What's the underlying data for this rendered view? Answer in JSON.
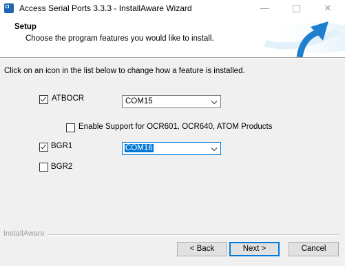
{
  "window": {
    "title": "Access Serial Ports 3.3.3 - InstallAware Wizard",
    "icon": "installaware-app-icon",
    "minimize_glyph": "—",
    "close_glyph": "✕"
  },
  "header": {
    "title": "Setup",
    "subtitle": "Choose the program features you would like to install."
  },
  "instruction": "Click on an icon in the list below to change how a feature is installed.",
  "features": {
    "atbocr": {
      "label": "ATBOCR",
      "checked": true,
      "port": "COM15"
    },
    "ocr_support": {
      "label": "Enable Support for OCR601, OCR640, ATOM Products",
      "checked": false
    },
    "bgr1": {
      "label": "BGR1",
      "checked": true,
      "port": "COM16"
    },
    "bgr2": {
      "label": "BGR2",
      "checked": false
    }
  },
  "footer": {
    "brand": "InstallAware",
    "back_label": "< Back",
    "next_label": "Next >",
    "cancel_label": "Cancel"
  },
  "colors": {
    "accent": "#0078d7",
    "header_bg": "#ffffff",
    "dialog_bg": "#f0f0f0"
  }
}
